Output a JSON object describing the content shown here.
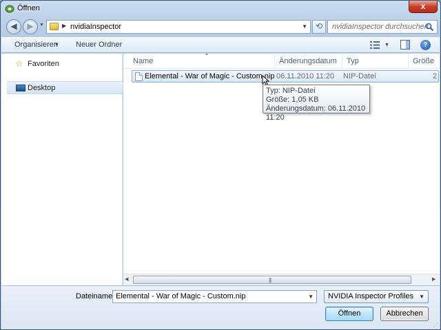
{
  "window": {
    "title": "Öffnen",
    "close_glyph": "x"
  },
  "address": {
    "path_segment": "nvidiaInspector",
    "search_placeholder": "nvidiaInspector durchsuchen"
  },
  "toolbar": {
    "organize_label": "Organisieren",
    "new_folder_label": "Neuer Ordner",
    "help_glyph": "?"
  },
  "nav": {
    "favorites_label": "Favoriten",
    "desktop_label": "Desktop"
  },
  "columns": {
    "name": "Name",
    "date": "Änderungsdatum",
    "type": "Typ",
    "size": "Größe"
  },
  "files": [
    {
      "name": "Elemental - War of Magic - Custom.nip",
      "date": "06.11.2010 11:20",
      "type": "NIP-Datei",
      "size": "2"
    }
  ],
  "tooltip": {
    "line1": "Typ: NIP-Datei",
    "line2": "Größe: 1,05 KB",
    "line3": "Änderungsdatum: 06.11.2010 11:20"
  },
  "bottom": {
    "filename_label": "Dateiname:",
    "filename_value": "Elemental - War of Magic - Custom.nip",
    "filter_value": "NVIDIA Inspector Profiles",
    "open_label": "Öffnen",
    "cancel_label": "Abbrechen"
  },
  "colors": {
    "selection": "#d9e9fa",
    "accent": "#1e395b",
    "close_button": "#c8412d"
  },
  "icons": [
    "app-icon",
    "back-icon",
    "forward-icon",
    "folder-icon",
    "refresh-icon",
    "search-icon",
    "views-icon",
    "preview-pane-icon",
    "help-icon",
    "star-icon",
    "desktop-icon",
    "file-icon",
    "cursor-icon"
  ]
}
